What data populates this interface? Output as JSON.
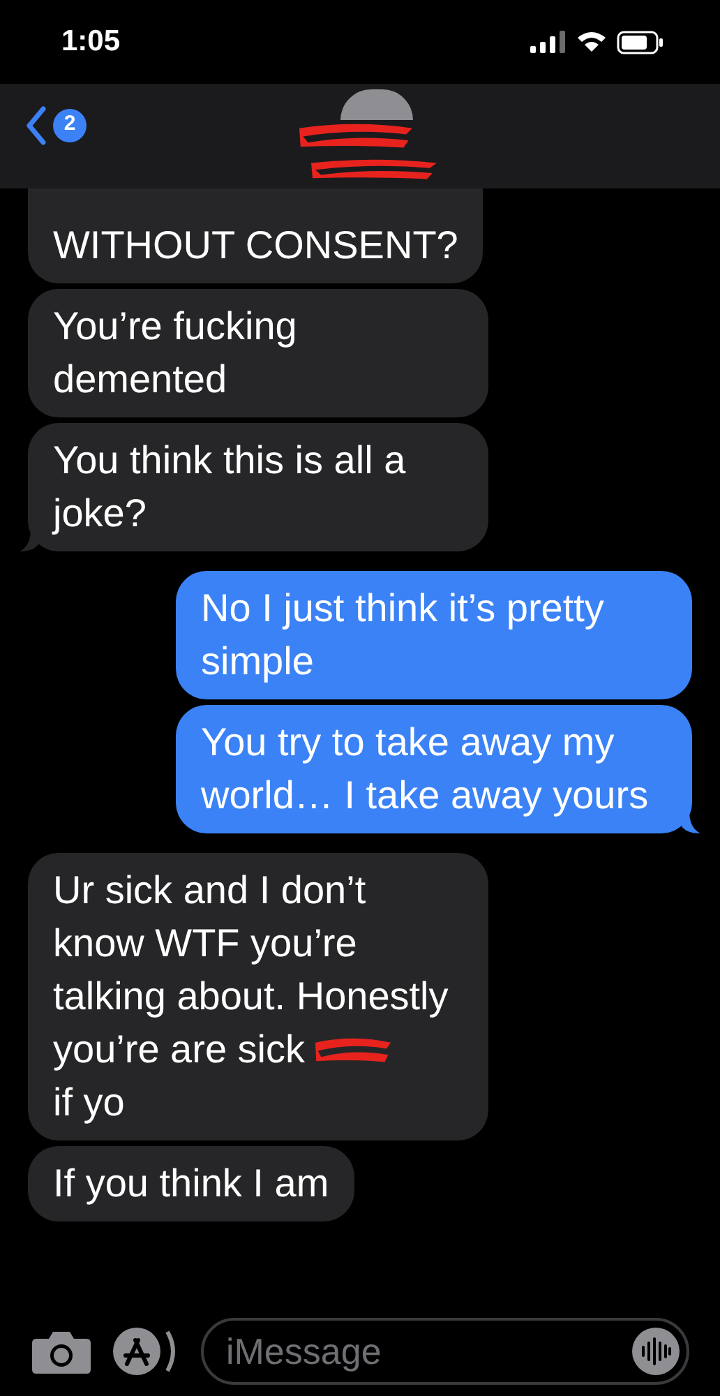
{
  "status_bar": {
    "time": "1:05"
  },
  "header": {
    "back_badge": "2"
  },
  "messages": [
    {
      "kind": "received",
      "text": "WITHOUT CONSENT?",
      "tail": false,
      "cut_top": true
    },
    {
      "kind": "received",
      "text": "You’re fucking demented",
      "tail": false,
      "cut_top": false
    },
    {
      "kind": "received",
      "text": "You think this is all a joke?",
      "tail": true,
      "cut_top": false
    },
    {
      "kind": "sent",
      "text": "No I just think it’s pretty simple",
      "tail": false,
      "cut_top": false
    },
    {
      "kind": "sent",
      "text": "You try to take away my world… I take away yours",
      "tail": true,
      "cut_top": false
    },
    {
      "kind": "received",
      "text": "Ur sick and I don’t know WTF you’re talking about. Honestly",
      "redacted_line": "you’re are sick",
      "after_redaction": "if yo",
      "tail": false,
      "cut_top": false
    },
    {
      "kind": "received",
      "text": "If you think I am",
      "tail": false,
      "cut_top": false
    }
  ],
  "composer": {
    "placeholder": "iMessage"
  }
}
